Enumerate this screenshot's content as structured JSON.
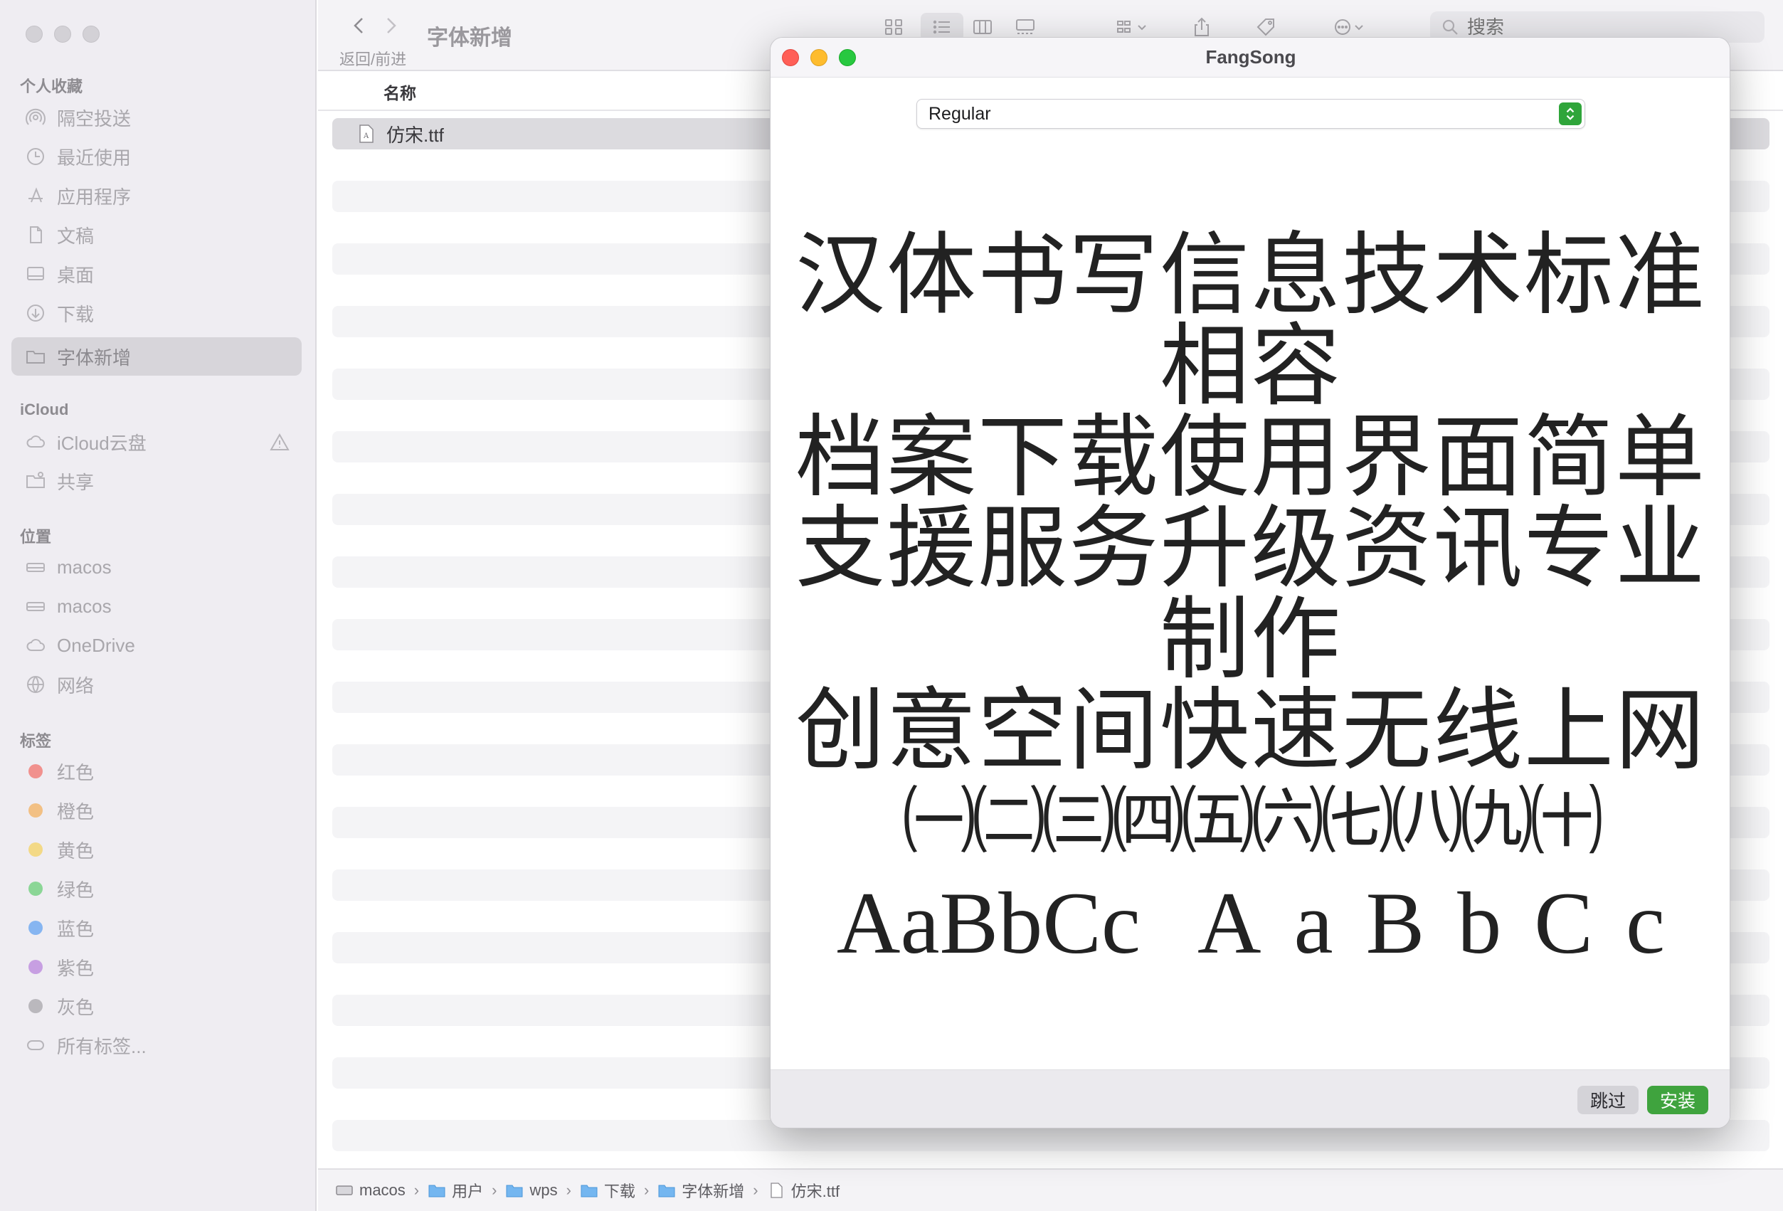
{
  "finder": {
    "title": "字体新增",
    "nav_caption": "返回/前进",
    "search_placeholder": "搜索",
    "column_name": "名称",
    "file_name": "仿宋.ttf"
  },
  "sidebar": {
    "favorites_label": "个人收藏",
    "favorites": [
      {
        "label": "隔空投送",
        "icon": "airdrop-icon"
      },
      {
        "label": "最近使用",
        "icon": "clock-icon"
      },
      {
        "label": "应用程序",
        "icon": "applications-icon"
      },
      {
        "label": "文稿",
        "icon": "document-icon"
      },
      {
        "label": "桌面",
        "icon": "desktop-icon"
      },
      {
        "label": "下载",
        "icon": "download-icon"
      },
      {
        "label": "字体新增",
        "icon": "folder-icon"
      }
    ],
    "icloud_label": "iCloud",
    "icloud": [
      {
        "label": "iCloud云盘",
        "icon": "cloud-icon"
      },
      {
        "label": "共享",
        "icon": "shared-folder-icon"
      }
    ],
    "locations_label": "位置",
    "locations": [
      {
        "label": "macos",
        "icon": "drive-icon"
      },
      {
        "label": "macos",
        "icon": "drive-icon"
      },
      {
        "label": "OneDrive",
        "icon": "cloud-icon"
      },
      {
        "label": "网络",
        "icon": "globe-icon"
      }
    ],
    "tags_label": "标签",
    "tags": [
      {
        "label": "红色",
        "color": "#f2453d"
      },
      {
        "label": "橙色",
        "color": "#f49a2a"
      },
      {
        "label": "黄色",
        "color": "#f5c92e"
      },
      {
        "label": "绿色",
        "color": "#38c24a"
      },
      {
        "label": "蓝色",
        "color": "#2f86f0"
      },
      {
        "label": "紫色",
        "color": "#a55ed6"
      },
      {
        "label": "灰色",
        "color": "#8e8d92"
      }
    ],
    "all_tags": "所有标签..."
  },
  "path_bar": [
    "macos",
    "用户",
    "wps",
    "下载",
    "字体新增",
    "仿宋.ttf"
  ],
  "dialog": {
    "title": "FangSong",
    "style_value": "Regular",
    "preview_lines": [
      "汉体书写信息技术标准相容",
      "档案下载使用界面简单",
      "支援服务升级资讯专业制作",
      "创意空间快速无线上网"
    ],
    "preview_numbers": "㈠㈡㈢㈣㈤㈥㈦㈧㈨㈩",
    "preview_latin_pairs": "AaBbCc",
    "preview_latin_single": [
      "A",
      "a",
      "B",
      "b",
      "C",
      "c"
    ],
    "skip_label": "跳过",
    "install_label": "安装"
  },
  "colors": {
    "install_button": "#3fa33e",
    "select_button": "#2fa53a",
    "close": "#ff5f57",
    "minimize": "#febc2e",
    "maximize": "#28c840"
  }
}
